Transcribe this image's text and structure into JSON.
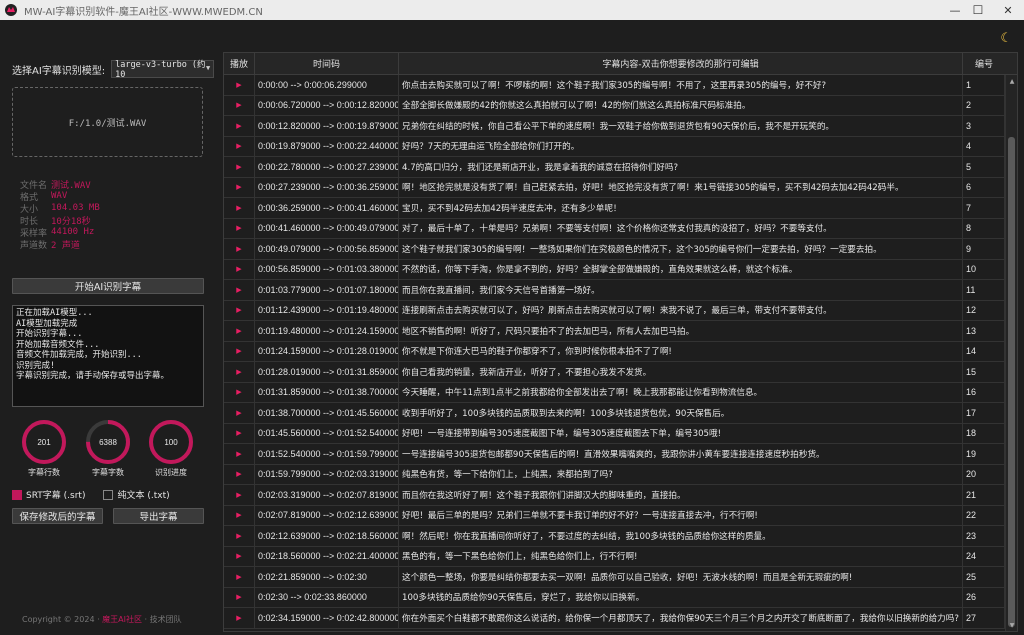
{
  "window": {
    "title": "MW-AI字幕识别软件-魔王AI社区-WWW.MWEDM.CN",
    "minimize": "—",
    "maximize": "☐",
    "close": "✕"
  },
  "theme_icon": "moon-icon",
  "left": {
    "model_label": "选择AI字幕识别模型:",
    "model_value": "large-v3-turbo (约 10",
    "drop_zone_text": "F:/1.0/测试.WAV",
    "file_info": [
      {
        "key": "文件名",
        "value": "测试.WAV"
      },
      {
        "key": "格式",
        "value": "WAV"
      },
      {
        "key": "大小",
        "value": "104.03 MB"
      },
      {
        "key": "时长",
        "value": "10分18秒"
      },
      {
        "key": "采样率",
        "value": "44100 Hz"
      },
      {
        "key": "声道数",
        "value": "2 声道"
      }
    ],
    "start_button": "开始AI识别字幕",
    "log_lines": [
      "正在加载AI模型...",
      "AI模型加载完成",
      "开始识别字幕...",
      "开始加载音频文件...",
      "音频文件加载完成，开始识别...",
      "识别完成!",
      "字幕识别完成，请手动保存或导出字幕。"
    ],
    "gauges": [
      {
        "value": "201",
        "label": "字幕行数",
        "fill": 1.0
      },
      {
        "value": "6388",
        "label": "字幕字数",
        "fill": 0.75
      },
      {
        "value": "100",
        "label": "识别进度",
        "fill": 1.0
      }
    ],
    "checkbox_srt": "SRT字幕 (.srt)",
    "checkbox_srt_checked": true,
    "checkbox_txt": "纯文本 (.txt)",
    "checkbox_txt_checked": false,
    "save_button": "保存修改后的字幕",
    "export_button": "导出字幕",
    "footer_copyright": "Copyright © 2024 · ",
    "footer_brand": "魔王AI社区",
    "footer_team": " · 技术团队"
  },
  "colors": {
    "accent": "#c2185b",
    "play": "#e91e63"
  },
  "table": {
    "headers": {
      "play": "播放",
      "time": "时间码",
      "text": "字幕内容-双击你想要修改的那行可编辑",
      "num": "编号"
    },
    "rows": [
      {
        "time": "0:00:00 --> 0:00:06.299000",
        "text": "你点击去购买就可以了啊！不啰嗦的啊！这个鞋子我们家305的编号啊！不用了，这里再录305的编号，好不好?",
        "num": "1"
      },
      {
        "time": "0:00:06.720000 --> 0:00:12.820000",
        "text": "全部全脚长做嫌殿的42的你就这么真拍就可以了啊！42的你们就这么真拍标准尺码标准拍。",
        "num": "2"
      },
      {
        "time": "0:00:12.820000 --> 0:00:19.879000",
        "text": "兄弟你在纠结的时候，你自己看公平下单的速度啊！我一双鞋子给你做到退货包有90天保价后，我不是开玩笑的。",
        "num": "3"
      },
      {
        "time": "0:00:19.879000 --> 0:00:22.440000",
        "text": "好吗？7天的无理由运飞险全部给你们打开的。",
        "num": "4"
      },
      {
        "time": "0:00:22.780000 --> 0:00:27.239000",
        "text": "4.7的高口归分，我们还是新店开业，我是拿着我的诚意在招待你们好吗?",
        "num": "5"
      },
      {
        "time": "0:00:27.239000 --> 0:00:36.259000",
        "text": "啊！地区抢完就是没有货了啊！自己赶紧去拍，好吧！地区抢完没有货了啊！来1号链接305的编号，买不到42码去加42码42码半。",
        "num": "6"
      },
      {
        "time": "0:00:36.259000 --> 0:00:41.460000",
        "text": "宝贝，买不到42码去加42码半速度去冲，还有多少单呢！",
        "num": "7"
      },
      {
        "time": "0:00:41.460000 --> 0:00:49.079000",
        "text": "对了，最后十单了，十单是吗？兄弟啊！不要等支付啊！这个价格你还常支付我真的没招了，好吗？不要等支付。",
        "num": "8"
      },
      {
        "time": "0:00:49.079000 --> 0:00:56.859000",
        "text": "这个鞋子就我们家305的编号啊！一整场如果你们在究极颜色的情况下，这个305的编号你们一定要去拍，好吗？一定要去拍。",
        "num": "9"
      },
      {
        "time": "0:00:56.859000 --> 0:01:03.380000",
        "text": "不然的话，你等下手淘，你是拿不到的，好吗？全脚掌全部做嫌殿的，直角效果就这么棒，就这个标准。",
        "num": "10"
      },
      {
        "time": "0:01:03.779000 --> 0:01:07.180000",
        "text": "而且你在我直播间，我们家今天信号首播第一场好。",
        "num": "11"
      },
      {
        "time": "0:01:12.439000 --> 0:01:19.480000",
        "text": "连接刷新点击去购买就可以了，好吗？刷新点击去购买就可以了啊！来我不说了，最后三单，带支付不要带支付。",
        "num": "12"
      },
      {
        "time": "0:01:19.480000 --> 0:01:24.159000",
        "text": "地区不销售的啊！听好了，尺码只要拍不了的去加巴马，所有人去加巴马拍。",
        "num": "13"
      },
      {
        "time": "0:01:24.159000 --> 0:01:28.019000",
        "text": "你不就是下你连大巴马的鞋子你都穿不了，你到时候你根本拍不了了啊!",
        "num": "14"
      },
      {
        "time": "0:01:28.019000 --> 0:01:31.859000",
        "text": "你自己看我的销量，我新店开业，听好了，不要担心我发不发货。",
        "num": "15"
      },
      {
        "time": "0:01:31.859000 --> 0:01:38.700000",
        "text": "今天睡醒，中午11点到1点半之前我都给你全部发出去了啊！晚上我那都能让你看到物流信息。",
        "num": "16"
      },
      {
        "time": "0:01:38.700000 --> 0:01:45.560000",
        "text": "收到手听好了，100多块钱的品质取到去来的啊！100多块钱退货包优，90天保售后。",
        "num": "17"
      },
      {
        "time": "0:01:45.560000 --> 0:01:52.540000",
        "text": "好吧！一号连接带到编号305速度截图下单，编号305速度截图去下单，编号305哦!",
        "num": "18"
      },
      {
        "time": "0:01:52.540000 --> 0:01:59.799000",
        "text": "一号连接编号305退货包邮都90天保售后的啊！直滑效果嘴嘴爽的，我跟你讲小黄车要连接连接速度秒拍秒货。",
        "num": "19"
      },
      {
        "time": "0:01:59.799000 --> 0:02:03.319000",
        "text": "纯黑色有货，等一下给你们上，上纯黑，来都拍到了吗?",
        "num": "20"
      },
      {
        "time": "0:02:03.319000 --> 0:02:07.819000",
        "text": "而且你在我这听好了啊！这个鞋子我跟你们讲脚汉大的脚味重的，直接拍。",
        "num": "21"
      },
      {
        "time": "0:02:07.819000 --> 0:02:12.639000",
        "text": "好吧！最后三单的是吗？兄弟们三单就不要卡我订单的好不好？一号连接直接去冲，行不行啊!",
        "num": "22"
      },
      {
        "time": "0:02:12.639000 --> 0:02:18.560000",
        "text": "啊！然后呢！你在我直播间你听好了，不要过度的去纠结，我100多块钱的品质给你这样的质量。",
        "num": "23"
      },
      {
        "time": "0:02:18.560000 --> 0:02:21.400000",
        "text": "黑色的有，等一下黑色给你们上，纯黑色给你们上，行不行啊!",
        "num": "24"
      },
      {
        "time": "0:02:21.859000 --> 0:02:30",
        "text": "这个颜色一整场，你要是纠结你都要去买一双啊！品质你可以自己验收，好吧！无波水线的啊！而且是全新无瑕疵的啊!",
        "num": "25"
      },
      {
        "time": "0:02:30 --> 0:02:33.860000",
        "text": "100多块钱的品质给你90天保售后，穿烂了，我给你以旧换新。",
        "num": "26"
      },
      {
        "time": "0:02:34.159000 --> 0:02:42.800000",
        "text": "你在外面买个白鞋都不敢跟你这么说话的，给你保一个月都顶天了，我给你保90天三个月三个月之内开交了断底断面了，我给你以旧换新的给力吗?",
        "num": "27"
      }
    ]
  }
}
